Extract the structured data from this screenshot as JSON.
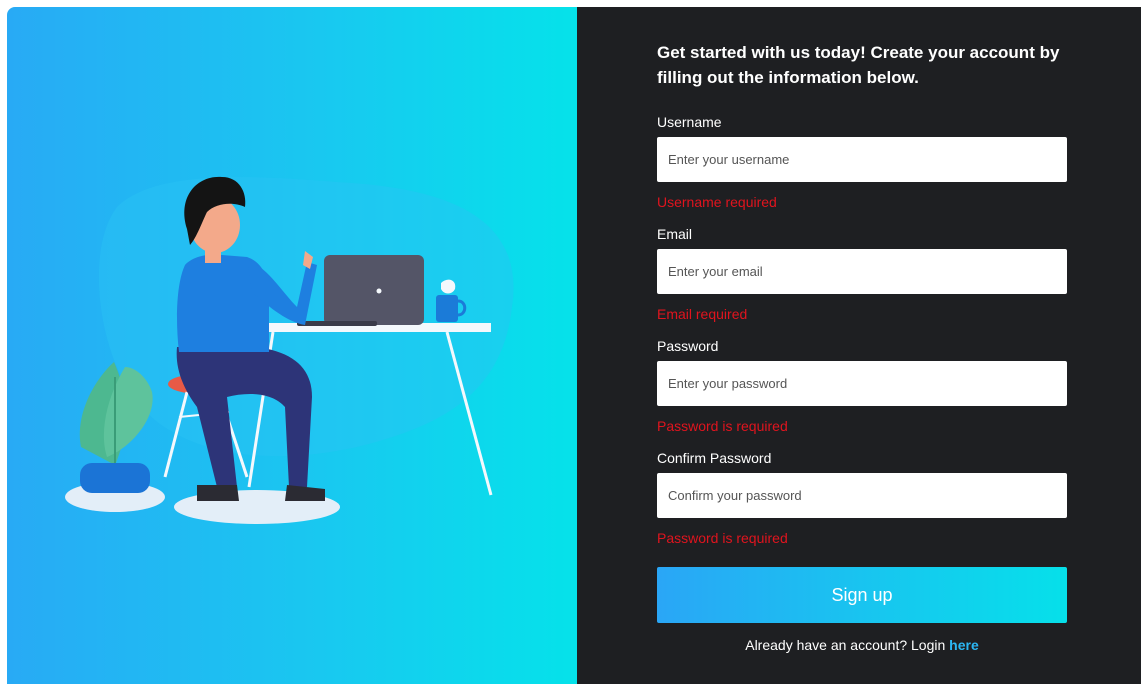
{
  "form": {
    "heading": "Get started with us today! Create your account by filling out the information below.",
    "fields": [
      {
        "label": "Username",
        "placeholder": "Enter your username",
        "value": "",
        "error": "Username required"
      },
      {
        "label": "Email",
        "placeholder": "Enter your email",
        "value": "",
        "error": "Email required"
      },
      {
        "label": "Password",
        "placeholder": "Enter your password",
        "value": "",
        "error": "Password is required"
      },
      {
        "label": "Confirm Password",
        "placeholder": "Confirm your password",
        "value": "",
        "error": "Password is required"
      }
    ],
    "submit_label": "Sign up",
    "login_prompt": "Already have an account? Login",
    "login_link": "here"
  },
  "colors": {
    "panel_dark": "#1e1f22",
    "gradient_start": "#28aaf5",
    "gradient_end": "#05e2ea",
    "error": "#e0141e",
    "link": "#2bb6f3"
  },
  "illustration": {
    "icons": [
      "person-at-desk-illustration",
      "laptop-icon",
      "mug-icon",
      "potted-plant-icon"
    ]
  }
}
